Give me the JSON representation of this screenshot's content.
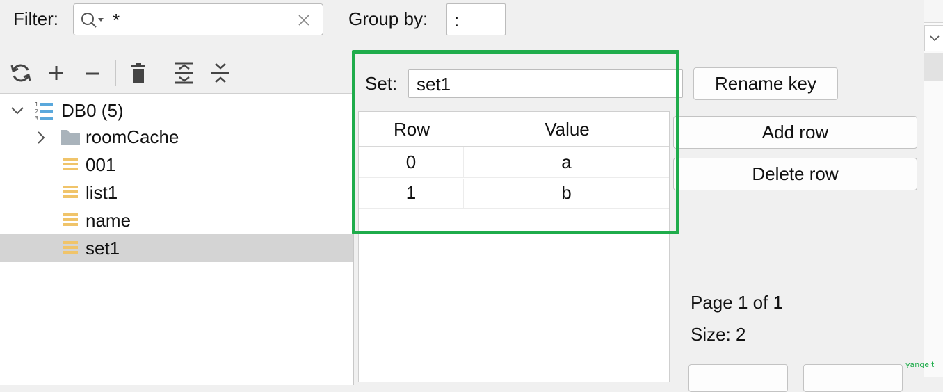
{
  "filter": {
    "label": "Filter:",
    "value": "*"
  },
  "group_by": {
    "label": "Group by:",
    "value": ":"
  },
  "toolbar": {
    "refresh": "refresh-icon",
    "add": "plus-icon",
    "remove": "minus-icon",
    "delete": "trash-icon",
    "expand": "expand-all-icon",
    "collapse": "collapse-all-icon"
  },
  "tree": {
    "db": {
      "label": "DB0 (5)"
    },
    "items": [
      {
        "label": "roomCache",
        "type": "folder"
      },
      {
        "label": "001",
        "type": "key"
      },
      {
        "label": "list1",
        "type": "key"
      },
      {
        "label": "name",
        "type": "key"
      },
      {
        "label": "set1",
        "type": "key",
        "selected": true
      }
    ]
  },
  "editor": {
    "set_label": "Set:",
    "set_value": "set1",
    "columns": [
      "Row",
      "Value"
    ],
    "rows": [
      {
        "row": "0",
        "value": "a"
      },
      {
        "row": "1",
        "value": "b"
      }
    ]
  },
  "actions": {
    "rename_key": "Rename key",
    "add_row": "Add row",
    "delete_row": "Delete row"
  },
  "pagination": {
    "page_text": "Page 1 of 1",
    "size_text": "Size: 2"
  },
  "watermark": "yangeit",
  "colors": {
    "highlight": "#1fac4b",
    "selected_row": "#d4d4d4",
    "key_icon": "#f0c46a",
    "folder_icon": "#a9b3bb"
  }
}
